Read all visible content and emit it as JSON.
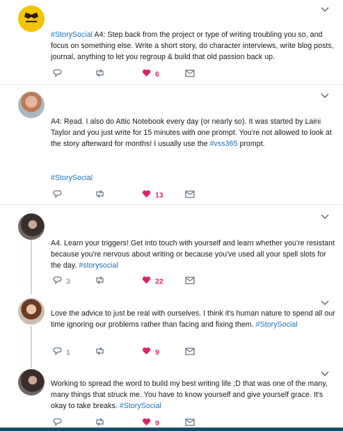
{
  "icons": {
    "reply": "reply-icon",
    "retweet": "retweet-icon",
    "like": "heart-icon",
    "dm": "envelope-icon",
    "more": "chevron-down-icon"
  },
  "colors": {
    "hashtag": "#1b73b6",
    "like": "#e0245e",
    "icon": "#657786",
    "thread": "#b7e1e6"
  },
  "tweets": [
    {
      "segments": [
        {
          "t": "#StorySocial",
          "tag": true
        },
        {
          "t": " A4: Step back from the project or type of writing troubling you so, and focus on something else. Write a short story, do character interviews, write blog posts, journal, anything to let you regroup & build that old passion back up.",
          "tag": false
        }
      ],
      "reply_count": "",
      "retweet_count": "",
      "like_count": "6"
    },
    {
      "segments": [
        {
          "t": "A4: Read.  I also do Attic Notebook every day (or nearly so).  It was started by Laini Taylor and you just write for 15 minutes with one prompt.  You're not allowed to look at the story afterward for months!  I usually use the ",
          "tag": false
        },
        {
          "t": "#vss365",
          "tag": true
        },
        {
          "t": " prompt.",
          "tag": false
        }
      ],
      "extra_tag": "#StorySocial",
      "reply_count": "",
      "retweet_count": "",
      "like_count": "13"
    },
    {
      "segments": [
        {
          "t": "A4. Learn your triggers! Get into touch with yourself and learn whether you're resistant because you're nervous about writing or because you've used all your spell slots for the day. ",
          "tag": false
        },
        {
          "t": "#storysocial",
          "tag": true
        }
      ],
      "reply_count": "3",
      "retweet_count": "",
      "like_count": "22"
    },
    {
      "segments": [
        {
          "t": "Love the advice to just be real with ourselves. I think it's human nature to spend all our time ignoring our problems rather than facing and fixing them. ",
          "tag": false
        },
        {
          "t": "#StorySocial",
          "tag": true
        }
      ],
      "reply_count": "1",
      "retweet_count": "",
      "like_count": "9"
    },
    {
      "segments": [
        {
          "t": "Working to spread the word to build my best writing life ;D that was one of the many, many things that struck me. You have to know yourself and give yourself grace. It's okay to take breaks. ",
          "tag": false
        },
        {
          "t": "#StorySocial",
          "tag": true
        }
      ],
      "reply_count": "",
      "retweet_count": "",
      "like_count": "9"
    }
  ]
}
